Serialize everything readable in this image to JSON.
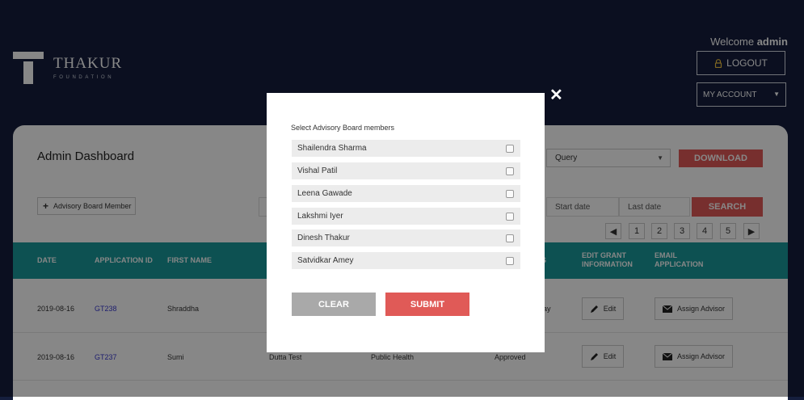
{
  "header": {
    "brand_name": "THAKUR",
    "brand_sub": "FOUNDATION",
    "welcome_text": "Welcome",
    "welcome_user": "admin",
    "logout_label": "LOGOUT",
    "account_label": "MY ACCOUNT"
  },
  "dashboard": {
    "title": "Admin Dashboard",
    "query_select": "Query",
    "download_label": "DOWNLOAD",
    "add_member_label": "Advisory Board Member",
    "start_date_placeholder": "Start date",
    "last_date_placeholder": "Last date",
    "search_label": "SEARCH",
    "pages": [
      "1",
      "2",
      "3",
      "4",
      "5"
    ]
  },
  "table": {
    "headers": {
      "date": "DATE",
      "app_id": "APPLICATION ID",
      "first_name": "FIRST NAME",
      "status": "S",
      "edit": "EDIT GRANT INFORMATION",
      "email": "EMAIL APPLICATION"
    },
    "rows": [
      {
        "date": "2019-08-16",
        "app_id": "GT238",
        "first_name": "Shraddha",
        "last_name": "",
        "category": "",
        "status": "ay",
        "edit_label": "Edit",
        "assign_label": "Assign Advisor"
      },
      {
        "date": "2019-08-16",
        "app_id": "GT237",
        "first_name": "Sumi",
        "last_name": "Dutta Test",
        "category": "Public Health",
        "status": "Approved",
        "edit_label": "Edit",
        "assign_label": "Assign Advisor"
      }
    ]
  },
  "modal": {
    "title": "Select Advisory Board members",
    "members": [
      "Shailendra Sharma",
      "Vishal Patil",
      "Leena Gawade",
      "Lakshmi Iyer",
      "Dinesh Thakur",
      "Satvidkar Amey"
    ],
    "clear_label": "CLEAR",
    "submit_label": "SUBMIT",
    "close_glyph": "✕"
  },
  "colors": {
    "navy": "#151e3d",
    "teal": "#1a9a9c",
    "accent_red": "#e05a57"
  }
}
